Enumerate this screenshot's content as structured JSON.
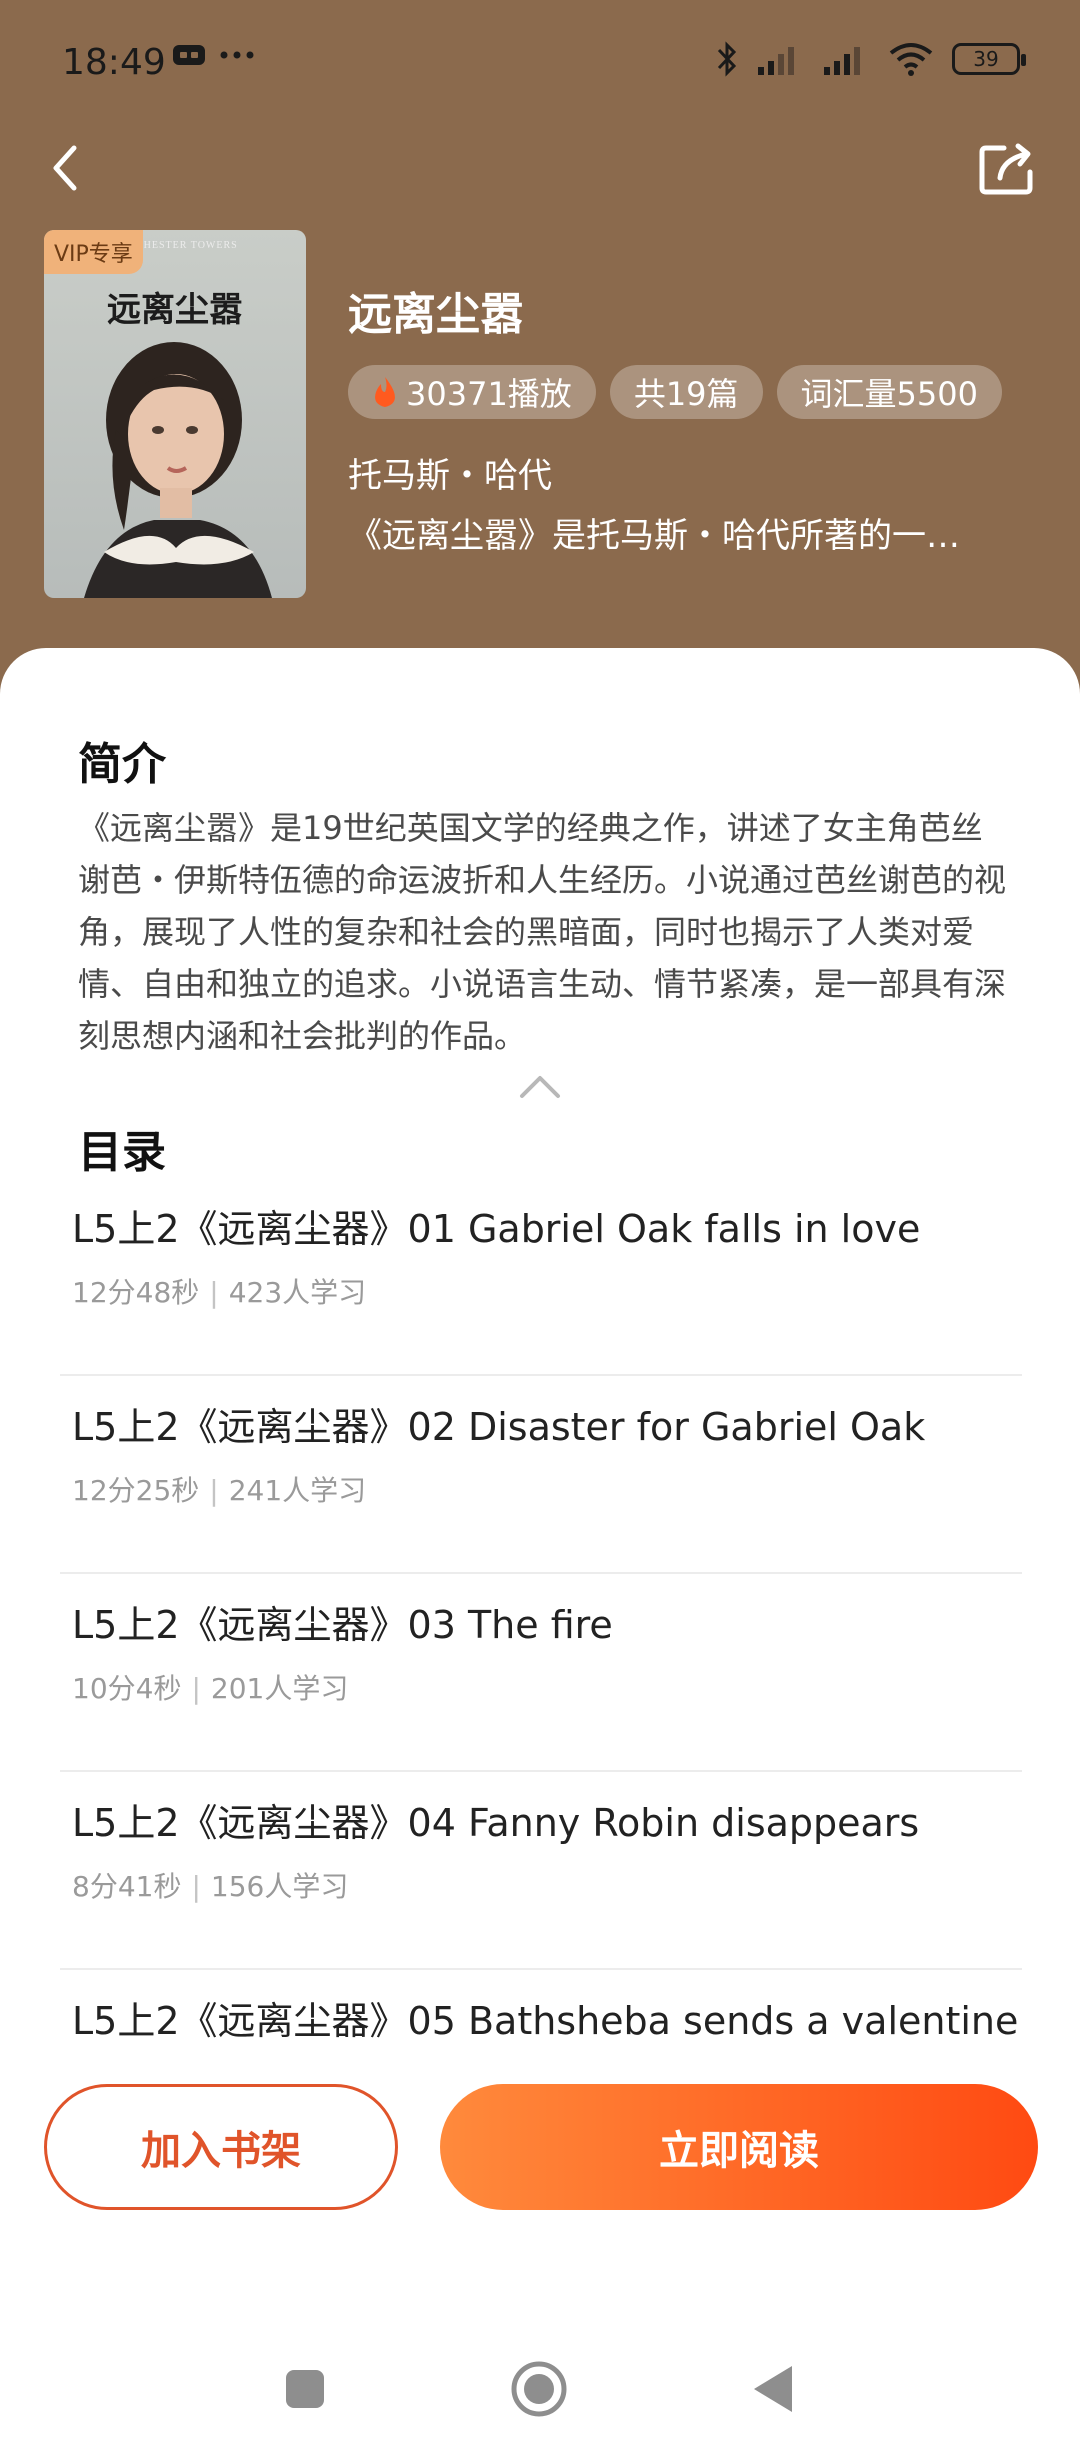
{
  "status_bar": {
    "time": "18:49",
    "battery": "39"
  },
  "book": {
    "cover_badge": "VIP专享",
    "cover_title": "远离尘嚣",
    "title": "远离尘嚣",
    "plays": "30371播放",
    "chapters": "共19篇",
    "vocabulary": "词汇量5500",
    "author": "托马斯・哈代",
    "short_desc": "《远离尘嚣》是托马斯・哈代所著的一…"
  },
  "intro": {
    "heading": "简介",
    "text": "《远离尘嚣》是19世纪英国文学的经典之作，讲述了女主角芭丝谢芭・伊斯特伍德的命运波折和人生经历。小说通过芭丝谢芭的视角，展现了人性的复杂和社会的黑暗面，同时也揭示了人类对爱情、自由和独立的追求。小说语言生动、情节紧凑，是一部具有深刻思想内涵和社会批判的作品。"
  },
  "toc": {
    "heading": "目录",
    "items": [
      {
        "title": "L5上2《远离尘器》01 Gabriel Oak falls in love",
        "duration": "12分48秒",
        "learners": "423人学习"
      },
      {
        "title": "L5上2《远离尘器》02 Disaster for Gabriel Oak",
        "duration": "12分25秒",
        "learners": "241人学习"
      },
      {
        "title": "L5上2《远离尘器》03 The fire",
        "duration": "10分4秒",
        "learners": "201人学习"
      },
      {
        "title": "L5上2《远离尘器》04 Fanny Robin disappears",
        "duration": "8分41秒",
        "learners": "156人学习"
      },
      {
        "title": "L5上2《远离尘器》05 Bathsheba sends a valentine",
        "duration": "",
        "learners": ""
      }
    ]
  },
  "actions": {
    "add_shelf": "加入书架",
    "read_now": "立即阅读"
  },
  "colors": {
    "header_bg": "#8b6a4d",
    "accent": "#ff4a12"
  }
}
